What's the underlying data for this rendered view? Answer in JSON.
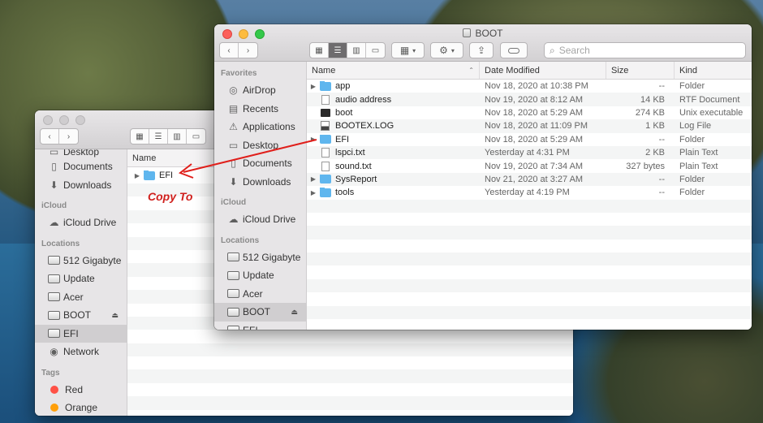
{
  "annotation": {
    "label": "Copy To"
  },
  "back_window": {
    "favorites_cut": "Desktop",
    "sidebar": {
      "favorites_tail": [
        {
          "label": "Documents",
          "icon": "documents-icon"
        },
        {
          "label": "Downloads",
          "icon": "downloads-icon"
        }
      ],
      "icloud_header": "iCloud",
      "icloud": [
        {
          "label": "iCloud Drive",
          "icon": "icloud-icon"
        }
      ],
      "locations_header": "Locations",
      "locations": [
        {
          "label": "512 Gigabyte",
          "icon": "drive-icon"
        },
        {
          "label": "Update",
          "icon": "drive-icon"
        },
        {
          "label": "Acer",
          "icon": "drive-icon"
        },
        {
          "label": "BOOT",
          "icon": "drive-icon",
          "eject": true
        },
        {
          "label": "EFI",
          "icon": "drive-icon",
          "selected": true
        },
        {
          "label": "Network",
          "icon": "network-icon"
        }
      ],
      "tags_header": "Tags",
      "tags": [
        {
          "label": "Red",
          "color": "#ff5146"
        },
        {
          "label": "Orange",
          "color": "#ff9f0a"
        }
      ]
    },
    "list": {
      "columns": {
        "name": "Name"
      },
      "rows": [
        {
          "name": "EFI",
          "kind": "folder"
        }
      ]
    }
  },
  "front_window": {
    "title": "BOOT",
    "search": {
      "placeholder": "Search"
    },
    "sidebar": {
      "favorites_header": "Favorites",
      "favorites": [
        {
          "label": "AirDrop",
          "icon": "airdrop-icon"
        },
        {
          "label": "Recents",
          "icon": "recents-icon"
        },
        {
          "label": "Applications",
          "icon": "applications-icon"
        },
        {
          "label": "Desktop",
          "icon": "desktop-icon"
        },
        {
          "label": "Documents",
          "icon": "documents-icon"
        },
        {
          "label": "Downloads",
          "icon": "downloads-icon"
        }
      ],
      "icloud_header": "iCloud",
      "icloud": [
        {
          "label": "iCloud Drive",
          "icon": "icloud-icon"
        }
      ],
      "locations_header": "Locations",
      "locations": [
        {
          "label": "512 Gigabyte",
          "icon": "drive-icon"
        },
        {
          "label": "Update",
          "icon": "drive-icon"
        },
        {
          "label": "Acer",
          "icon": "drive-icon"
        },
        {
          "label": "BOOT",
          "icon": "drive-icon",
          "eject": true,
          "selected": true
        },
        {
          "label": "EFI",
          "icon": "drive-icon"
        }
      ]
    },
    "list": {
      "columns": {
        "name": "Name",
        "date": "Date Modified",
        "size": "Size",
        "kind": "Kind"
      },
      "rows": [
        {
          "name": "app",
          "date": "Nov 18, 2020 at 10:38 PM",
          "size": "--",
          "kind": "Folder",
          "type": "folder",
          "expandable": true
        },
        {
          "name": "audio address",
          "date": "Nov 19, 2020 at 8:12 AM",
          "size": "14 KB",
          "kind": "RTF Document",
          "type": "doc",
          "expandable": false
        },
        {
          "name": "boot",
          "date": "Nov 18, 2020 at 5:29 AM",
          "size": "274 KB",
          "kind": "Unix executable",
          "type": "exe",
          "expandable": false
        },
        {
          "name": "BOOTEX.LOG",
          "date": "Nov 18, 2020 at 11:09 PM",
          "size": "1 KB",
          "kind": "Log File",
          "type": "log",
          "expandable": false
        },
        {
          "name": "EFI",
          "date": "Nov 18, 2020 at 5:29 AM",
          "size": "--",
          "kind": "Folder",
          "type": "folder",
          "expandable": true
        },
        {
          "name": "lspci.txt",
          "date": "Yesterday at 4:31 PM",
          "size": "2 KB",
          "kind": "Plain Text",
          "type": "doc",
          "expandable": false
        },
        {
          "name": "sound.txt",
          "date": "Nov 19, 2020 at 7:34 AM",
          "size": "327 bytes",
          "kind": "Plain Text",
          "type": "doc",
          "expandable": false
        },
        {
          "name": "SysReport",
          "date": "Nov 21, 2020 at 3:27 AM",
          "size": "--",
          "kind": "Folder",
          "type": "folder",
          "expandable": true
        },
        {
          "name": "tools",
          "date": "Yesterday at 4:19 PM",
          "size": "--",
          "kind": "Folder",
          "type": "folder",
          "expandable": true
        }
      ]
    }
  }
}
